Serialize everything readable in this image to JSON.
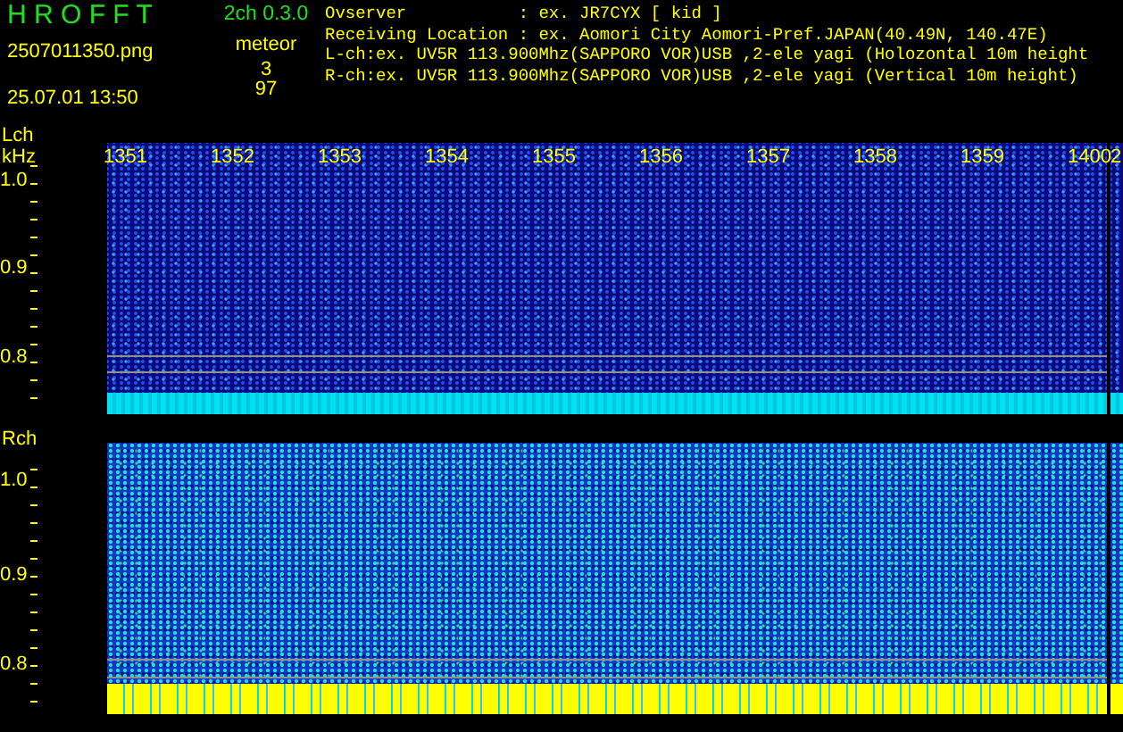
{
  "header": {
    "app_title": "H R O F F T",
    "version": "2ch 0.3.0",
    "filename": "2507011350.png",
    "datetime": "25.07.01 13:50",
    "count_label": "meteor",
    "counts": [
      "3",
      "97"
    ],
    "info_lines": [
      "Ovserver           : ex. JR7CYX [ kid ]",
      "Receiving Location : ex. Aomori City Aomori-Pref.JAPAN(40.49N, 140.47E)",
      "L-ch:ex. UV5R 113.900Mhz(SAPPORO VOR)USB ,2-ele yagi (Holozontal 10m height",
      "R-ch:ex. UV5R 113.900Mhz(SAPPORO VOR)USB ,2-ele yagi (Vertical 10m height)"
    ]
  },
  "panels": [
    {
      "channel": "Lch",
      "unit": "kHz",
      "kind": "left",
      "yticks": [
        "1.0",
        "0.9",
        "0.8"
      ],
      "time_labels": [
        "1351",
        "1352",
        "1353",
        "1354",
        "1355",
        "1356",
        "1357",
        "1358",
        "1359",
        "1400"
      ],
      "side_label": "2"
    },
    {
      "channel": "Rch",
      "kind": "right",
      "yticks": [
        "1.0",
        "0.9",
        "0.8"
      ]
    }
  ]
}
